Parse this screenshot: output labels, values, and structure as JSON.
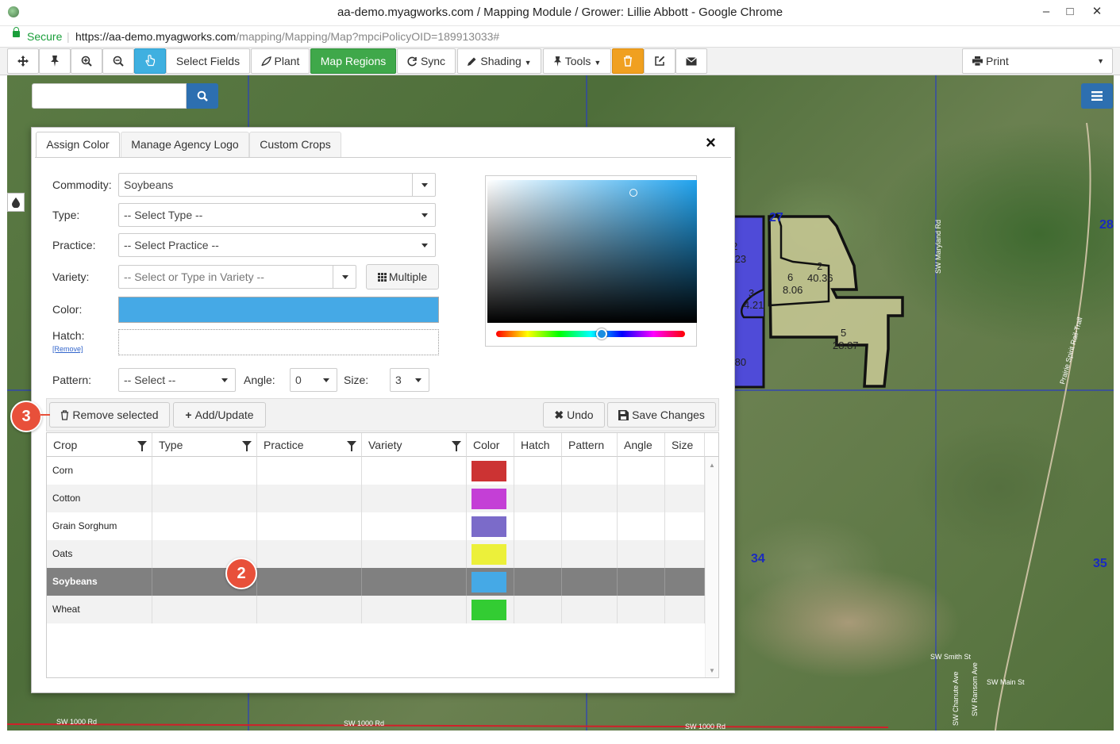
{
  "window": {
    "title": "aa-demo.myagworks.com / Mapping Module / Grower: Lillie Abbott - Google Chrome",
    "controls": [
      "–",
      "□",
      "✕"
    ]
  },
  "address_bar": {
    "secure_label": "Secure",
    "url_prefix": "https://aa-demo.myagworks.com",
    "url_path": "/mapping/Mapping/Map?mpciPolicyOID=189913033#"
  },
  "toolbar": {
    "select_fields": "Select Fields",
    "plant": "Plant",
    "map_regions": "Map Regions",
    "sync": "Sync",
    "shading": "Shading",
    "tools": "Tools",
    "print": "Print",
    "colors": {
      "active_green": "#3fa84a",
      "pointer_blue": "#3fb0e0",
      "delete_orange": "#f0a020"
    }
  },
  "map": {
    "search_placeholder": "",
    "section_labels": [
      "27",
      "28",
      "34",
      "35"
    ],
    "road_labels": [
      "SW Maryland Rd",
      "Prairie Spirit Rail-Trail",
      "SW Smith St",
      "SW Main St",
      "SW Chanute Ave",
      "SW Ransom Ave",
      "SW 1000 Rd",
      "SW 1000 Rd",
      "SW 1000 Rd"
    ],
    "fields": [
      {
        "id": "2",
        "acres": "40.36"
      },
      {
        "id": "6",
        "acres": "8.06"
      },
      {
        "id": "3",
        "acres": "4.21"
      },
      {
        "id": "5",
        "acres": "28.87"
      }
    ],
    "partial_labels": [
      "2",
      ".23",
      ".80"
    ]
  },
  "dialog": {
    "tabs": [
      "Assign Color",
      "Manage Agency Logo",
      "Custom Crops"
    ],
    "close": "×",
    "form": {
      "commodity_label": "Commodity:",
      "commodity_value": "Soybeans",
      "type_label": "Type:",
      "type_value": "-- Select Type --",
      "practice_label": "Practice:",
      "practice_value": "-- Select Practice --",
      "variety_label": "Variety:",
      "variety_placeholder": "-- Select or Type in Variety --",
      "multiple_button": "Multiple",
      "color_label": "Color:",
      "color_value": "#45a9e6",
      "hatch_label": "Hatch:",
      "hatch_remove": "[Remove]",
      "pattern_label": "Pattern:",
      "pattern_value": "-- Select --",
      "angle_label": "Angle:",
      "angle_value": "0",
      "size_label": "Size:",
      "size_value": "3"
    },
    "actions": {
      "remove_selected": "Remove selected",
      "add_update": "Add/Update",
      "undo": "Undo",
      "save_changes": "Save Changes"
    },
    "grid": {
      "columns": [
        "Crop",
        "Type",
        "Practice",
        "Variety",
        "Color",
        "Hatch",
        "Pattern",
        "Angle",
        "Size"
      ],
      "rows": [
        {
          "crop": "Corn",
          "color": "#cc3333",
          "selected": false
        },
        {
          "crop": "Cotton",
          "color": "#c43fd6",
          "selected": false
        },
        {
          "crop": "Grain Sorghum",
          "color": "#7b6bc9",
          "selected": false
        },
        {
          "crop": "Oats",
          "color": "#ecf03a",
          "selected": false
        },
        {
          "crop": "Soybeans",
          "color": "#45a9e6",
          "selected": true
        },
        {
          "crop": "Wheat",
          "color": "#33cc33",
          "selected": false
        }
      ]
    }
  },
  "callouts": [
    "3",
    "2"
  ]
}
